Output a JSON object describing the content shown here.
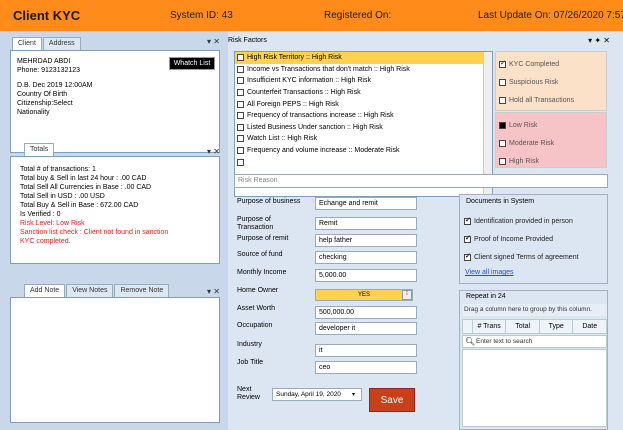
{
  "header": {
    "title": "Client KYC",
    "system_id": "System ID: 43",
    "registered_on": "Registered On:",
    "last_update": "Last Update On: 07/26/2020 7:57"
  },
  "client_panel": {
    "tabs": [
      "Client",
      "Address"
    ],
    "name": "MEHRDAD ABDI",
    "phone": "Phone: 9123132123",
    "dob": "D.B. Dec 2019 12:00AM",
    "country_of_birth": "Country Of Birth",
    "citizenship": "Citizenship:Select",
    "nationality": "Nationality",
    "watch_list_button": "Whatch List"
  },
  "totals_panel": {
    "tab": "Totals",
    "lines": [
      "Total # of transactions: 1",
      "Total buy & Sell in last 24 hour : .00 CAD",
      "Total Sell All Currencies in Base : .00 CAD",
      "Total Sell in USD : .00 USD",
      "Total Buy & Sell in Base : 672.00 CAD",
      "Is Verified : 0"
    ],
    "red_lines": [
      "Risk Level: Low Risk",
      "Sanction list check : Client not found in sanction",
      "KYC completed."
    ]
  },
  "notes_panel": {
    "tabs": [
      "Add Note",
      "View Notes",
      "Remove Note"
    ]
  },
  "risk_factors": {
    "title": "Risk Factors",
    "items": [
      {
        "label": "High Risk Territory  :: High Risk",
        "checked": false,
        "selected": true
      },
      {
        "label": "Income vs Transactions that don't match :: High Risk",
        "checked": false,
        "selected": false
      },
      {
        "label": "Insufficient KYC information :: High Risk",
        "checked": false,
        "selected": false
      },
      {
        "label": "Counterfeit Transactions :: High Risk",
        "checked": false,
        "selected": false
      },
      {
        "label": "All Foreign PEPS :: High Risk",
        "checked": false,
        "selected": false
      },
      {
        "label": "Frequency of transactions increase :: High Risk",
        "checked": false,
        "selected": false
      },
      {
        "label": "Listed Business Under sanction :: High Risk",
        "checked": false,
        "selected": false
      },
      {
        "label": "Watch List :: High Risk",
        "checked": false,
        "selected": false
      },
      {
        "label": "Frequency and volume increase :: Moderate Risk",
        "checked": false,
        "selected": false
      },
      {
        "label": "",
        "checked": false,
        "selected": false
      }
    ]
  },
  "kyc_status": {
    "items": [
      {
        "label": "KYC Completed",
        "checked": true
      },
      {
        "label": "Suspicious Risk",
        "checked": false
      },
      {
        "label": "Hold all Transactions",
        "checked": false
      }
    ],
    "bg": "#fbe1c8"
  },
  "risk_level": {
    "items": [
      {
        "label": "Low Risk",
        "checked": true
      },
      {
        "label": "Moderate Risk",
        "checked": false
      },
      {
        "label": "High Risk",
        "checked": false
      }
    ],
    "bg": "#f6c4c6"
  },
  "risk_reason": {
    "placeholder": "Risk Reason"
  },
  "form": {
    "purpose_of_business_label": "Purpose of business",
    "purpose_of_business": "Echange and remit",
    "purpose_of_transaction_label": "Purpose of Transaction",
    "purpose_of_transaction": "Remit",
    "purpose_of_remit_label": "Purpose of remit",
    "purpose_of_remit": "help father",
    "source_of_fund_label": "Source of fund",
    "source_of_fund": "checking",
    "monthly_income_label": "Monthly Income",
    "monthly_income": "5,000.00",
    "home_owner_label": "Home Owner",
    "home_owner": "YES",
    "asset_worth_label": "Asset Worth",
    "asset_worth": "500,000.00",
    "occupation_label": "Occupation",
    "occupation": "developer it",
    "industry_label": "Industry",
    "industry": "it",
    "job_title_label": "Job Title",
    "job_title": "ceo",
    "next_review_label": "Next Review",
    "next_review": "Sunday, April 19, 2020",
    "save_button": "Save"
  },
  "documents": {
    "title": "Documents in System",
    "items": [
      {
        "label": "Identification provided in person",
        "checked": true
      },
      {
        "label": "Proof of Income Provided",
        "checked": true
      },
      {
        "label": "Client signed Terms of agreement",
        "checked": true
      }
    ],
    "view_all": "View all images"
  },
  "repeat": {
    "title": "Repeat in 24",
    "hint": "Drag a column here to group by this column.",
    "columns": [
      "# Trans",
      "Total",
      "Type",
      "Date"
    ],
    "search_placeholder": "Enter text to search"
  },
  "colors": {
    "header": "#ff8c1a",
    "save_button": "#c7401a",
    "home_owner": "#ffd24d"
  }
}
